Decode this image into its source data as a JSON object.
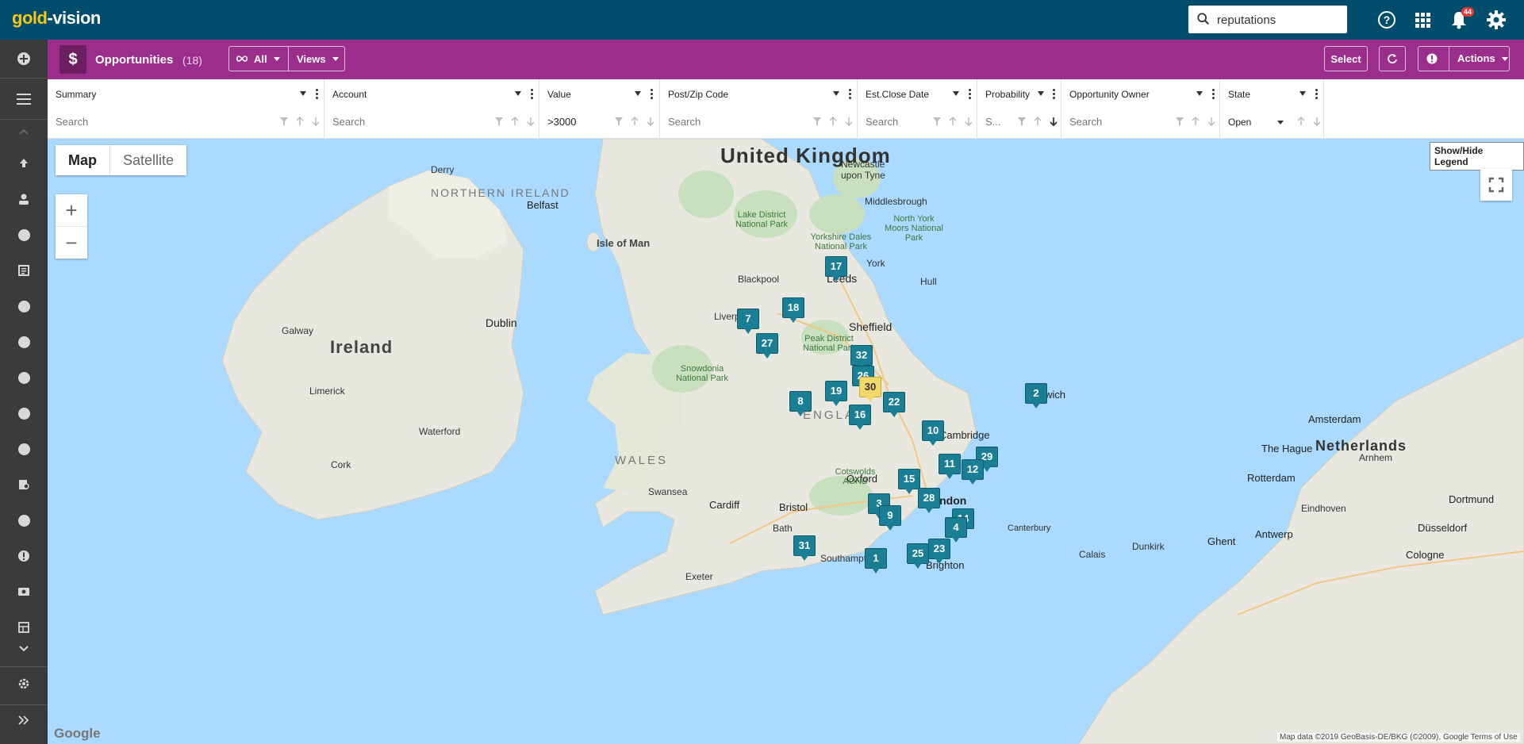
{
  "app": {
    "logo_gold": "gold",
    "logo_rest": "-vision"
  },
  "search": {
    "value": "reputations"
  },
  "notifications": {
    "count": "44"
  },
  "header": {
    "title": "Opportunities",
    "count": "(18)",
    "filter_label": "All",
    "views_label": "Views",
    "select_label": "Select",
    "actions_label": "Actions"
  },
  "columns": [
    {
      "title": "Summary",
      "search": "",
      "placeholder": "Search"
    },
    {
      "title": "Account",
      "search": "",
      "placeholder": "Search"
    },
    {
      "title": "Value",
      "search": ">3000",
      "placeholder": "Search"
    },
    {
      "title": "Post/Zip Code",
      "search": "",
      "placeholder": "Search"
    },
    {
      "title": "Est.Close Date",
      "search": "",
      "placeholder": "Search"
    },
    {
      "title": "Probability",
      "search": "",
      "placeholder": "S..."
    },
    {
      "title": "Opportunity Owner",
      "search": "",
      "placeholder": "Search"
    },
    {
      "title": "State",
      "search": "Open",
      "placeholder": ""
    }
  ],
  "map": {
    "type_map": "Map",
    "type_satellite": "Satellite",
    "zoom_in": "+",
    "zoom_out": "−",
    "legend_button": "Show/Hide Legend",
    "google": "Google",
    "attribution": "Map data ©2019 GeoBasis-DE/BKG (©2009), Google    Terms of Use",
    "labels": {
      "uk": "United Kingdom",
      "ireland": "Ireland",
      "northern_ireland": "NORTHERN IRELAND",
      "wales": "WALES",
      "england": "ENGLA",
      "isle_of_man": "Isle of Man",
      "netherlands": "Netherlands",
      "dublin": "Dublin",
      "belfast": "Belfast",
      "leeds": "Leeds",
      "sheffield": "Sheffield",
      "norwich": "Norwich",
      "cambridge": "Cambridge",
      "oxford": "Oxford",
      "london": "London",
      "bristol": "Bristol",
      "cardiff": "Cardiff",
      "brighton": "Brighton",
      "amsterdam": "Amsterdam",
      "rotterdam": "Rotterdam",
      "york": "York",
      "liverpool": "Liverpool",
      "newcastle": "Newcastle upon Tyne",
      "cork": "Cork",
      "galway": "Galway",
      "limerick": "Limerick",
      "antwerp": "Antwerp",
      "dusseldorf": "Düsseldorf",
      "swansea": "Swansea",
      "exeter": "Exeter",
      "southampton": "Southampton",
      "bath": "Bath",
      "middlesbrough": "Middlesbrough",
      "blackpool": "Blackpool",
      "hull": "Hull",
      "ghent": "Ghent",
      "eindhoven": "Eindhoven",
      "cologne": "Cologne",
      "dortmund": "Dortmund",
      "canterbury": "Canterbury",
      "calais": "Calais",
      "dunkirk": "Dunkirk",
      "arnhem": "Arnhem",
      "the_hague": "The Hague",
      "derry": "Derry",
      "waterford": "Waterford",
      "snowdonia": "Snowdonia National Park",
      "lake_district": "Lake District National Park",
      "peak_district": "Peak District National Park",
      "yorkshire_dales": "Yorkshire Dales National Park",
      "north_york_moors": "North York Moors National Park",
      "cotswolds": "Cotswolds AONB"
    },
    "markers": [
      {
        "label": "17",
        "highlight": false
      },
      {
        "label": "18",
        "highlight": false
      },
      {
        "label": "7",
        "highlight": false
      },
      {
        "label": "27",
        "highlight": false
      },
      {
        "label": "32",
        "highlight": false
      },
      {
        "label": "26",
        "highlight": false
      },
      {
        "label": "30",
        "highlight": true
      },
      {
        "label": "19",
        "highlight": false
      },
      {
        "label": "8",
        "highlight": false
      },
      {
        "label": "22",
        "highlight": false
      },
      {
        "label": "16",
        "highlight": false
      },
      {
        "label": "2",
        "highlight": false
      },
      {
        "label": "10",
        "highlight": false
      },
      {
        "label": "11",
        "highlight": false
      },
      {
        "label": "29",
        "highlight": false
      },
      {
        "label": "12",
        "highlight": false
      },
      {
        "label": "15",
        "highlight": false
      },
      {
        "label": "28",
        "highlight": false
      },
      {
        "label": "3",
        "highlight": false
      },
      {
        "label": "9",
        "highlight": false
      },
      {
        "label": "14",
        "highlight": false
      },
      {
        "label": "4",
        "highlight": false
      },
      {
        "label": "25",
        "highlight": false
      },
      {
        "label": "23",
        "highlight": false
      },
      {
        "label": "31",
        "highlight": false
      },
      {
        "label": "1",
        "highlight": false
      }
    ]
  },
  "colors": {
    "topbar": "#004c6d",
    "header": "#9c2e8b",
    "sidebar": "#3b3b3b",
    "marker": "#1a7f95",
    "marker_highlight": "#f2d76b",
    "sea": "#aadaff",
    "land": "#e8e8e0"
  }
}
